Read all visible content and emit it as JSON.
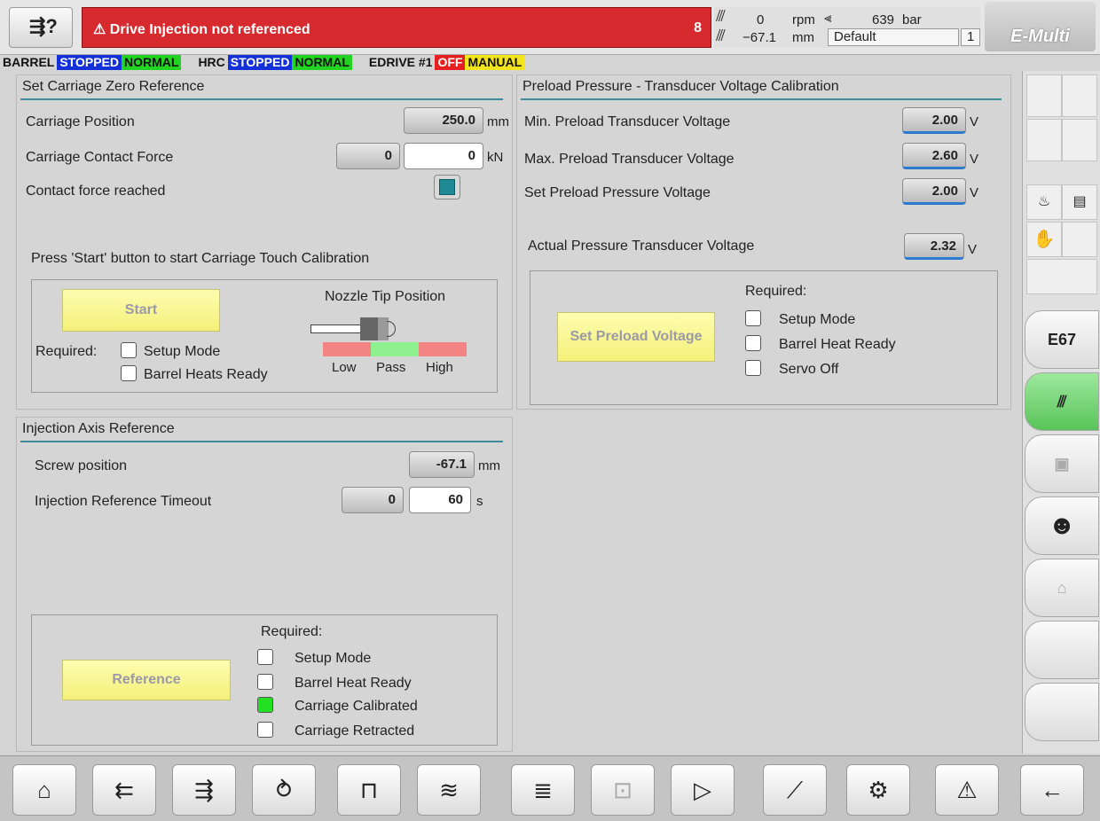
{
  "header": {
    "alarm_message": "⚠ Drive Injection not referenced",
    "alarm_count": "8",
    "rpm_value": "0",
    "rpm_unit": "rpm",
    "pressure_value": "639",
    "pressure_unit": "bar",
    "pos_value": "−67.1",
    "pos_unit": "mm",
    "profile_value": "Default",
    "profile_num": "1",
    "logo": "E-Multi"
  },
  "status": [
    {
      "text": "BARREL",
      "bg": "#d4d4d4",
      "fg": "#111"
    },
    {
      "text": "STOPPED",
      "bg": "#1430d8",
      "fg": "#ffffff"
    },
    {
      "text": "NORMAL",
      "bg": "#22d322",
      "fg": "#111"
    },
    {
      "text": "HRC",
      "bg": "#d4d4d4",
      "fg": "#111"
    },
    {
      "text": "STOPPED",
      "bg": "#1430d8",
      "fg": "#ffffff"
    },
    {
      "text": "NORMAL",
      "bg": "#22d322",
      "fg": "#111"
    },
    {
      "text": "EDRIVE #1",
      "bg": "#d4d4d4",
      "fg": "#111"
    },
    {
      "text": "OFF",
      "bg": "#e62020",
      "fg": "#ffffff"
    },
    {
      "text": "MANUAL",
      "bg": "#f3e51c",
      "fg": "#111"
    }
  ],
  "carriage": {
    "title": "Set Carriage Zero Reference",
    "position_label": "Carriage Position",
    "position_value": "250.0",
    "position_unit": "mm",
    "force_label": "Carriage Contact Force",
    "force_actual": "0",
    "force_set": "0",
    "force_unit": "kN",
    "reached_label": "Contact force reached",
    "instruction": "Press 'Start' button to start Carriage Touch Calibration",
    "start_label": "Start",
    "required_label": "Required:",
    "req_setup": "Setup Mode",
    "req_barrel": "Barrel Heats Ready",
    "nozzle_title": "Nozzle Tip Position",
    "low": "Low",
    "pass": "Pass",
    "high": "High"
  },
  "preload": {
    "title": "Preload Pressure - Transducer Voltage Calibration",
    "min_label": "Min. Preload Transducer Voltage",
    "min_value": "2.00",
    "max_label": "Max. Preload Transducer Voltage",
    "max_value": "2.60",
    "set_label": "Set Preload Pressure Voltage",
    "set_value": "2.00",
    "actual_label": "Actual Pressure Transducer Voltage",
    "actual_value": "2.32",
    "unit": "V",
    "button_label": "Set Preload Voltage",
    "required_label": "Required:",
    "req_setup": "Setup Mode",
    "req_barrel": "Barrel Heat Ready",
    "req_servo": "Servo Off"
  },
  "injection": {
    "title": "Injection Axis Reference",
    "screw_label": "Screw position",
    "screw_value": "-67.1",
    "screw_unit": "mm",
    "timeout_label": "Injection Reference Timeout",
    "timeout_actual": "0",
    "timeout_set": "60",
    "timeout_unit": "s",
    "button_label": "Reference",
    "required_label": "Required:",
    "req_setup": "Setup Mode",
    "req_barrel": "Barrel Heat Ready",
    "req_calibrated": "Carriage Calibrated",
    "req_retracted": "Carriage Retracted"
  },
  "sidebar": {
    "e67_label": "E67"
  },
  "bottom_nav": [
    {
      "name": "home-icon",
      "glyph": "⌂"
    },
    {
      "name": "screw-back-icon",
      "glyph": "⇇"
    },
    {
      "name": "screw-inject-icon",
      "glyph": "⇶"
    },
    {
      "name": "screw-rotate-icon",
      "glyph": "⥁"
    },
    {
      "name": "temperature-profile-icon",
      "glyph": "⊓"
    },
    {
      "name": "heater-icon",
      "glyph": "≋"
    },
    {
      "name": "list-icon",
      "glyph": "≣"
    },
    {
      "name": "mold-icon",
      "glyph": "⊡"
    },
    {
      "name": "valve-gate-icon",
      "glyph": "▷"
    },
    {
      "name": "chart-icon",
      "glyph": "⟋"
    },
    {
      "name": "settings-icon",
      "glyph": "⚙"
    },
    {
      "name": "alarm-icon",
      "glyph": "⚠"
    },
    {
      "name": "back-arrow-icon",
      "glyph": "←"
    }
  ]
}
